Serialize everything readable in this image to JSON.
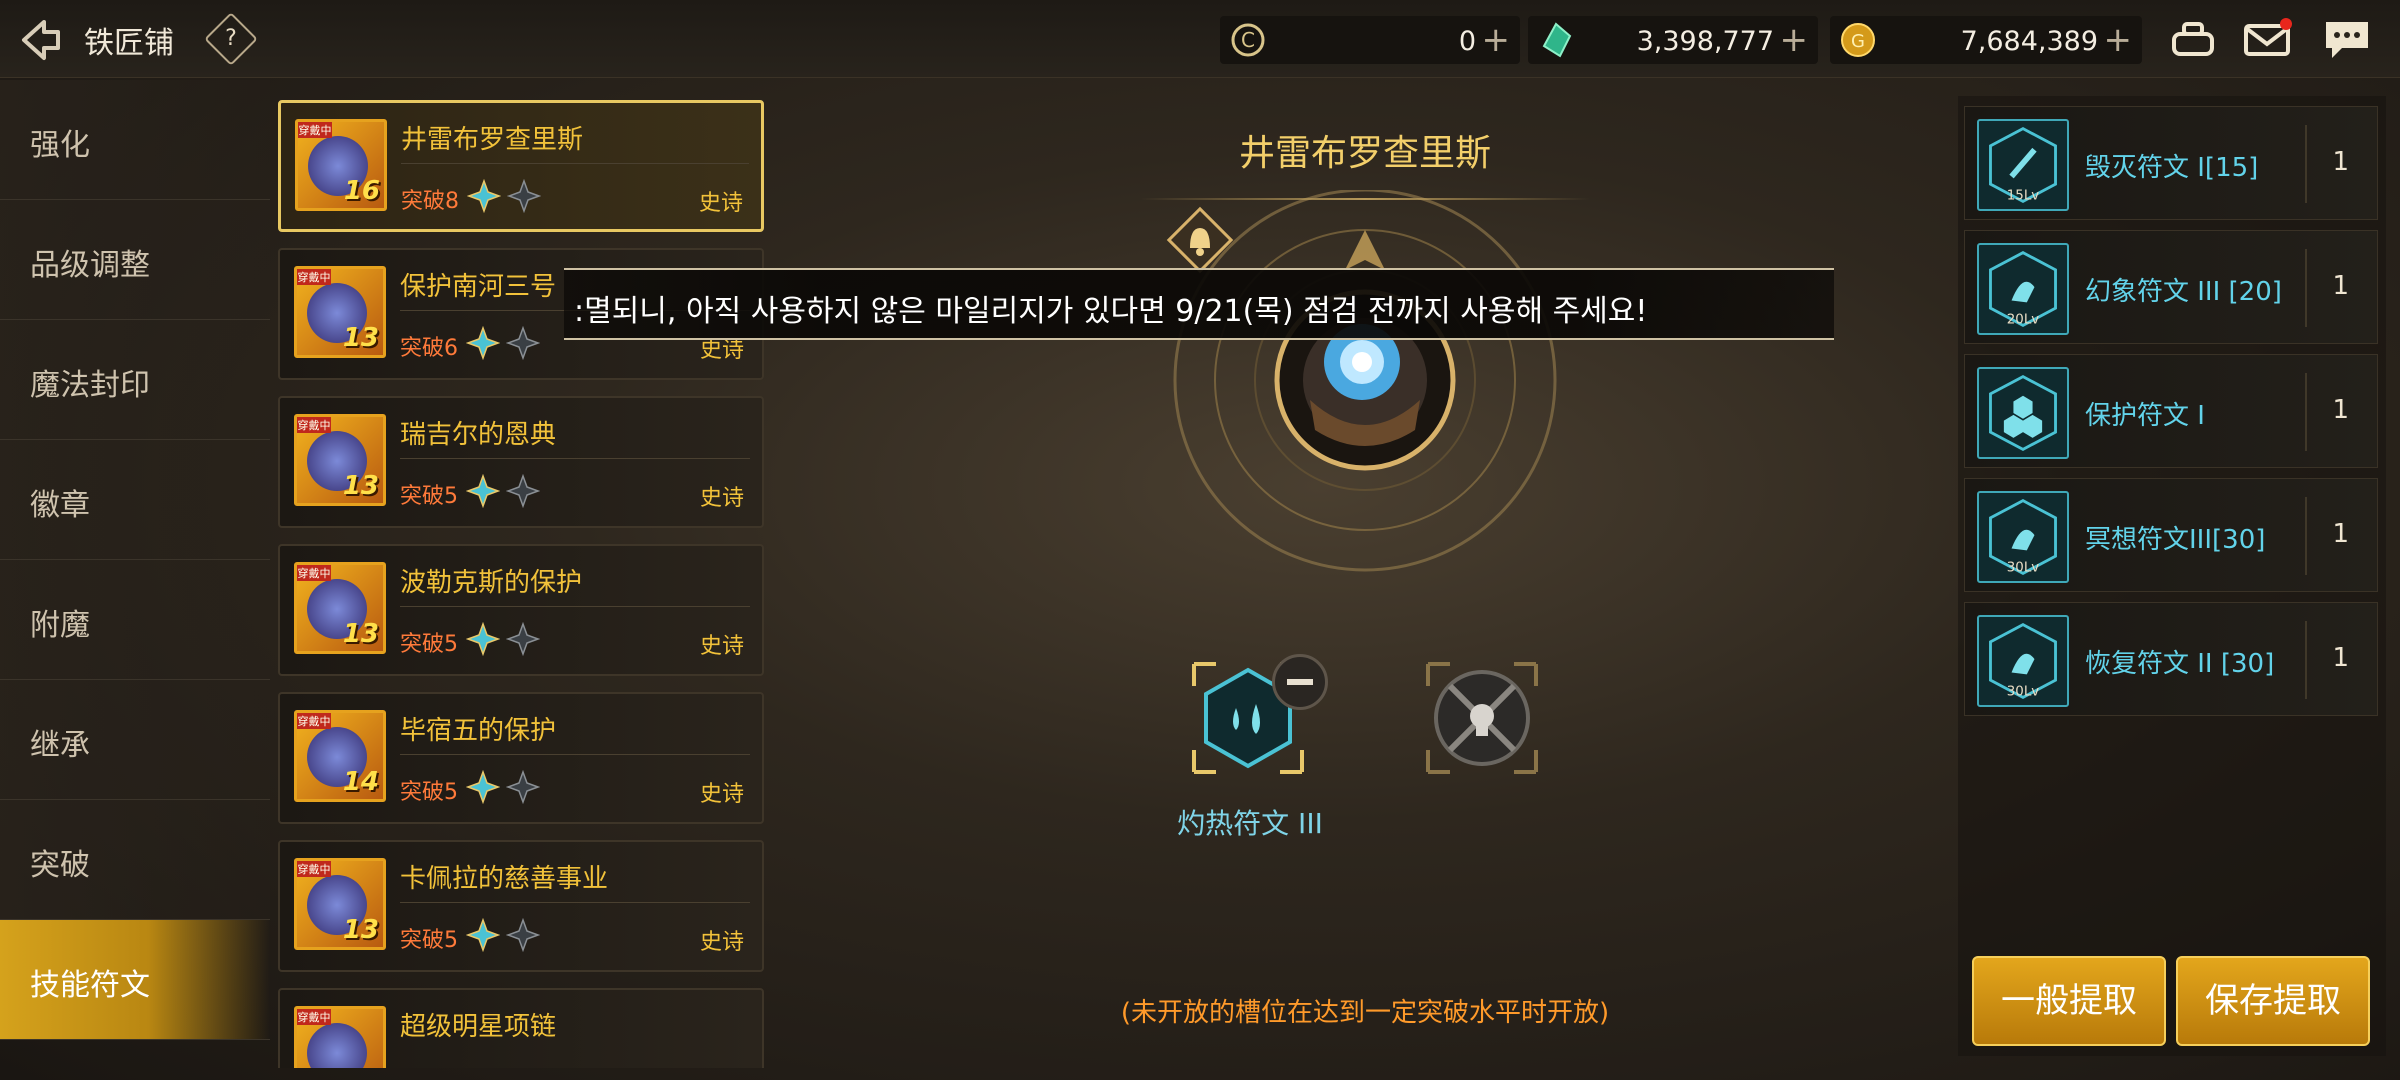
{
  "header": {
    "title": "铁匠铺",
    "help": "?",
    "currencies": [
      {
        "icon": "c-coin-icon",
        "value": "0",
        "plus": "+"
      },
      {
        "icon": "green-crystal-icon",
        "value": "3,398,777",
        "plus": "+"
      },
      {
        "icon": "gold-coin-icon",
        "value": "7,684,389",
        "plus": "+"
      }
    ],
    "icons": [
      "cart-icon",
      "mail-icon",
      "chat-icon"
    ]
  },
  "menu": {
    "items": [
      {
        "label": "强化"
      },
      {
        "label": "品级调整"
      },
      {
        "label": "魔法封印"
      },
      {
        "label": "徽章"
      },
      {
        "label": "附魔"
      },
      {
        "label": "继承"
      },
      {
        "label": "突破"
      },
      {
        "label": "技能符文"
      }
    ],
    "active_index": 7
  },
  "items": [
    {
      "name": "井雷布罗查里斯",
      "break": "突破8",
      "grade": "史诗",
      "level": "16",
      "tag": "穿戴中"
    },
    {
      "name": "保护南河三号",
      "break": "突破6",
      "grade": "史诗",
      "level": "13",
      "tag": "穿戴中"
    },
    {
      "name": "瑞吉尔的恩典",
      "break": "突破5",
      "grade": "史诗",
      "level": "13",
      "tag": "穿戴中"
    },
    {
      "name": "波勒克斯的保护",
      "break": "突破5",
      "grade": "史诗",
      "level": "13",
      "tag": "穿戴中"
    },
    {
      "name": "毕宿五的保护",
      "break": "突破5",
      "grade": "史诗",
      "level": "14",
      "tag": "穿戴中"
    },
    {
      "name": "卡佩拉的慈善事业",
      "break": "突破5",
      "grade": "史诗",
      "level": "13",
      "tag": "穿戴中"
    },
    {
      "name": "超级明星项链",
      "break": "",
      "grade": "",
      "level": "",
      "tag": "穿戴中"
    }
  ],
  "center": {
    "title": "井雷布罗查里斯",
    "banner": ":멸되니, 아직 사용하지 않은 마일리지가 있다면 9/21(목) 점검 전까지 사용해 주세요!",
    "slot1_label": "灼热符文 III",
    "note": "(未开放的槽位在达到一定突破水平时开放)"
  },
  "runes": [
    {
      "name": "毁灭符文 I[15]",
      "qty": "1",
      "lv": "15Lv"
    },
    {
      "name": "幻象符文 III [20]",
      "qty": "1",
      "lv": "20Lv"
    },
    {
      "name": "保护符文 I",
      "qty": "1",
      "lv": ""
    },
    {
      "name": "冥想符文III[30]",
      "qty": "1",
      "lv": "30Lv"
    },
    {
      "name": "恢复符文 II [30]",
      "qty": "1",
      "lv": "30Lv"
    }
  ],
  "buttons": {
    "normal_extract": "一般提取",
    "save_extract": "保存提取"
  }
}
